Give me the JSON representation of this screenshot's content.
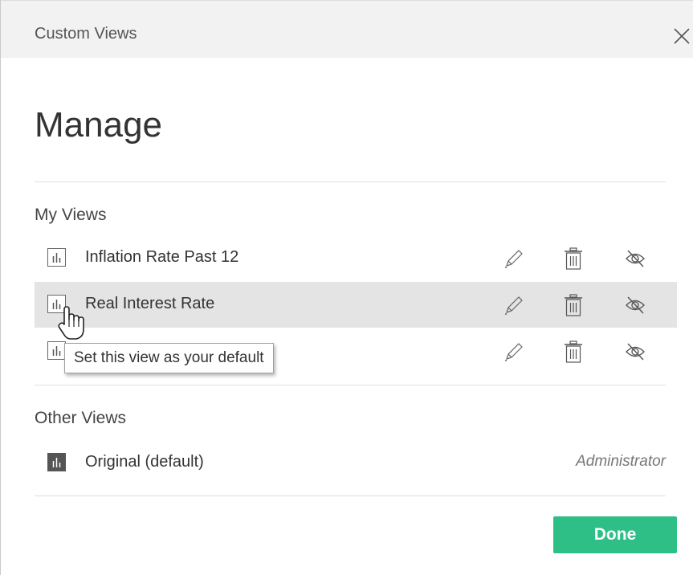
{
  "dialog": {
    "title": "Custom Views",
    "heading": "Manage"
  },
  "my_views": {
    "label": "My Views",
    "items": [
      {
        "label": "Inflation Rate Past 12",
        "state": "normal"
      },
      {
        "label": "Real Interest Rate",
        "state": "hover"
      },
      {
        "label": "",
        "state": "normal"
      }
    ]
  },
  "tooltip": {
    "text": "Set this view as your default"
  },
  "other_views": {
    "label": "Other Views",
    "items": [
      {
        "label": "Original (default)",
        "owner": "Administrator"
      }
    ]
  },
  "footer": {
    "done_label": "Done"
  },
  "icons": {
    "close": "close-icon",
    "view": "bar-chart-icon",
    "edit": "pencil-icon",
    "delete": "trash-icon",
    "hide": "eye-slash-icon"
  },
  "colors": {
    "accent": "#2ebf86",
    "hover_row": "#e4e4e4",
    "title_bar": "#f2f2f2"
  }
}
